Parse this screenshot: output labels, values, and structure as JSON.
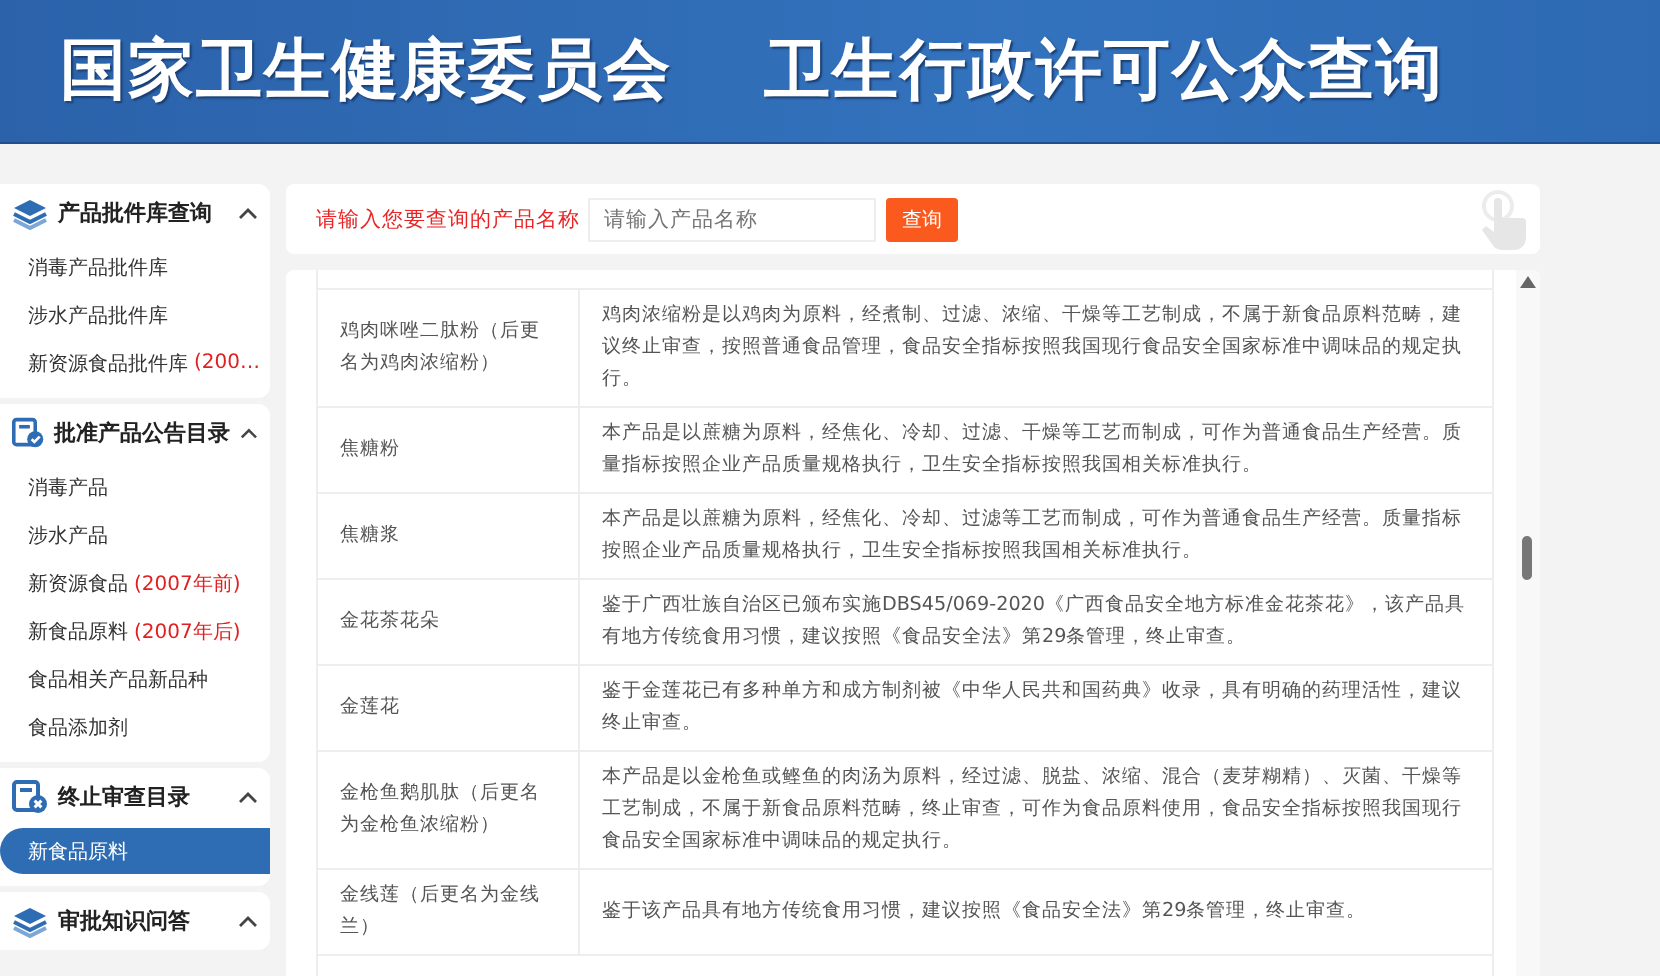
{
  "header": {
    "titles": [
      "国家卫生健康委员会",
      "卫生行政许可公众查询"
    ]
  },
  "sidebar": {
    "sections": [
      {
        "title": "产品批件库查询",
        "kind": "layers",
        "expanded": true,
        "items": [
          {
            "label": "消毒产品批件库",
            "selected": false
          },
          {
            "label": "涉水产品批件库",
            "selected": false
          },
          {
            "label": "新资源食品批件库",
            "note": "(200…",
            "selected": false
          }
        ]
      },
      {
        "title": "批准产品公告目录",
        "kind": "approved",
        "expanded": true,
        "items": [
          {
            "label": "消毒产品",
            "selected": false
          },
          {
            "label": "涉水产品",
            "selected": false
          },
          {
            "label": "新资源食品",
            "note": "(2007年前)",
            "selected": false
          },
          {
            "label": "新食品原料",
            "note": "(2007年后)",
            "selected": false
          },
          {
            "label": "食品相关产品新品种",
            "selected": false
          },
          {
            "label": "食品添加剂",
            "selected": false
          }
        ]
      },
      {
        "title": "终止审查目录",
        "kind": "stopped",
        "expanded": true,
        "items": [
          {
            "label": "新食品原料",
            "selected": true
          }
        ]
      },
      {
        "title": "审批知识问答",
        "kind": "layers",
        "expanded": true
      }
    ]
  },
  "search": {
    "label": "请输入您要查询的产品名称",
    "placeholder": "请输入产品名称",
    "button": "查询"
  },
  "table": {
    "rows": [
      {
        "name": "鸡肉咪唑二肽粉（后更名为鸡肉浓缩粉）",
        "description": "鸡肉浓缩粉是以鸡肉为原料，经煮制、过滤、浓缩、干燥等工艺制成，不属于新食品原料范畴，建议终止审查，按照普通食品管理，食品安全指标按照我国现行食品安全国家标准中调味品的规定执行。"
      },
      {
        "name": "焦糖粉",
        "description": "本产品是以蔗糖为原料，经焦化、冷却、过滤、干燥等工艺而制成，可作为普通食品生产经营。质量指标按照企业产品质量规格执行，卫生安全指标按照我国相关标准执行。"
      },
      {
        "name": "焦糖浆",
        "description": "本产品是以蔗糖为原料，经焦化、冷却、过滤等工艺而制成，可作为普通食品生产经营。质量指标按照企业产品质量规格执行，卫生安全指标按照我国相关标准执行。"
      },
      {
        "name": "金花茶花朵",
        "description": "鉴于广西壮族自治区已颁布实施DBS45/069-2020《广西食品安全地方标准金花茶花》，该产品具有地方传统食用习惯，建议按照《食品安全法》第29条管理，终止审查。"
      },
      {
        "name": "金莲花",
        "description": "鉴于金莲花已有多种单方和成方制剂被《中华人民共和国药典》收录，具有明确的药理活性，建议终止审查。"
      },
      {
        "name": "金枪鱼鹅肌肽（后更名为金枪鱼浓缩粉）",
        "description": "本产品是以金枪鱼或鲣鱼的肉汤为原料，经过滤、脱盐、浓缩、混合（麦芽糊精）、灭菌、干燥等工艺制成，不属于新食品原料范畴，终止审查，可作为食品原料使用，食品安全指标按照我国现行食品安全国家标准中调味品的规定执行。"
      },
      {
        "name": "金线莲（后更名为金线兰）",
        "description": "鉴于该产品具有地方传统食用习惯，建议按照《食品安全法》第29条管理，终止审查。"
      }
    ]
  }
}
